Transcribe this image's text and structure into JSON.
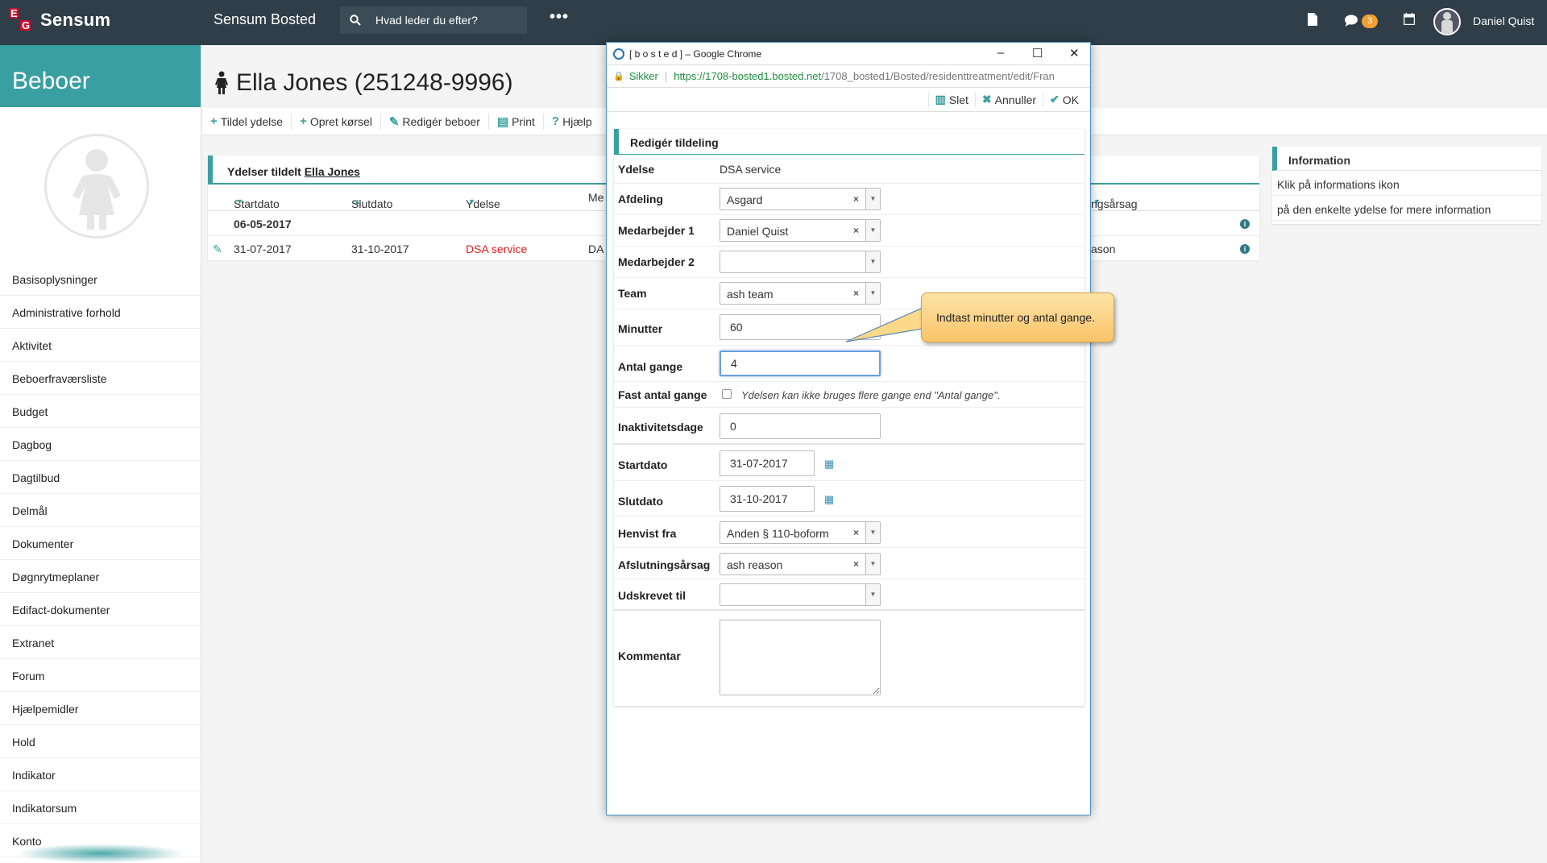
{
  "topbar": {
    "brand": "Sensum",
    "logo_letters": [
      "E",
      "G"
    ],
    "app_title": "Sensum Bosted",
    "search_placeholder": "Hvad leder du efter?",
    "more_label": "•••",
    "notification_count": "3",
    "user_name": "Daniel Quist"
  },
  "sidebar": {
    "title": "Beboer",
    "items": [
      "Basisoplysninger",
      "Administrative forhold",
      "Aktivitet",
      "Beboerfraværsliste",
      "Budget",
      "Dagbog",
      "Dagtilbud",
      "Delmål",
      "Dokumenter",
      "Døgnrytmeplaner",
      "Edifact-dokumenter",
      "Extranet",
      "Forum",
      "Hjælpemidler",
      "Hold",
      "Indikator",
      "Indikatorsum",
      "Konto"
    ]
  },
  "main": {
    "page_title": "Ella Jones (251248-9996)",
    "actions": [
      {
        "icon": "+",
        "label": "Tildel ydelse"
      },
      {
        "icon": "+",
        "label": "Opret kørsel"
      },
      {
        "icon": "✎",
        "label": "Redigér beboer"
      },
      {
        "icon": "▤",
        "label": "Print"
      },
      {
        "icon": "?",
        "label": "Hjælp"
      }
    ],
    "panel": {
      "title_prefix": "Ydelser tildelt",
      "title_link": "Ella Jones",
      "columns": [
        "Startdato",
        "Slutdato",
        "Ydelse",
        "Me",
        "ngsårsag"
      ],
      "group_date": "06-05-2017",
      "row": {
        "start": "31-07-2017",
        "end": "31-10-2017",
        "service": "DSA service",
        "employee_partial": "DA",
        "reason_partial": "ason"
      }
    },
    "info": {
      "title": "Information",
      "lines": [
        "Klik på informations ikon",
        "på den enkelte ydelse for mere information"
      ]
    }
  },
  "popup": {
    "window_title": "[ b o s t e d ] – Google Chrome",
    "secure_label": "Sikker",
    "url_host": "https://1708-bosted1.bosted.net",
    "url_path": "/1708_bosted1/Bosted/residenttreatment/edit/Fran",
    "tools": [
      {
        "icon": "🗑",
        "label": "Slet"
      },
      {
        "icon": "✖",
        "label": "Annuller"
      },
      {
        "icon": "✔",
        "label": "OK"
      }
    ],
    "form": {
      "title": "Redigér tildeling",
      "ydelse": {
        "label": "Ydelse",
        "value": "DSA service"
      },
      "afdeling": {
        "label": "Afdeling",
        "value": "Asgard"
      },
      "medarbejder1": {
        "label": "Medarbejder 1",
        "value": "Daniel Quist"
      },
      "medarbejder2": {
        "label": "Medarbejder 2",
        "value": ""
      },
      "team": {
        "label": "Team",
        "value": "ash team"
      },
      "minutter": {
        "label": "Minutter",
        "value": "60"
      },
      "antal_gange": {
        "label": "Antal gange",
        "value": "4"
      },
      "fast_antal": {
        "label": "Fast antal gange",
        "checked": false,
        "note": "Ydelsen kan ikke bruges flere gange end \"Antal gange\"."
      },
      "inaktivitet": {
        "label": "Inaktivitetsdage",
        "value": "0"
      },
      "startdato": {
        "label": "Startdato",
        "value": "31-07-2017"
      },
      "slutdato": {
        "label": "Slutdato",
        "value": "31-10-2017"
      },
      "henvist_fra": {
        "label": "Henvist fra",
        "value": "Anden § 110-boform"
      },
      "afslutningsaarsag": {
        "label": "Afslutningsårsag",
        "value": "ash reason"
      },
      "udskrevet_til": {
        "label": "Udskrevet til",
        "value": ""
      },
      "kommentar": {
        "label": "Kommentar",
        "value": ""
      }
    }
  },
  "callout": {
    "text": "Indtast minutter og antal gange."
  },
  "colors": {
    "topbar": "#2f3e48",
    "accent": "#3a9fa0",
    "service_red": "#e02020",
    "callout": "#f9c46a"
  }
}
